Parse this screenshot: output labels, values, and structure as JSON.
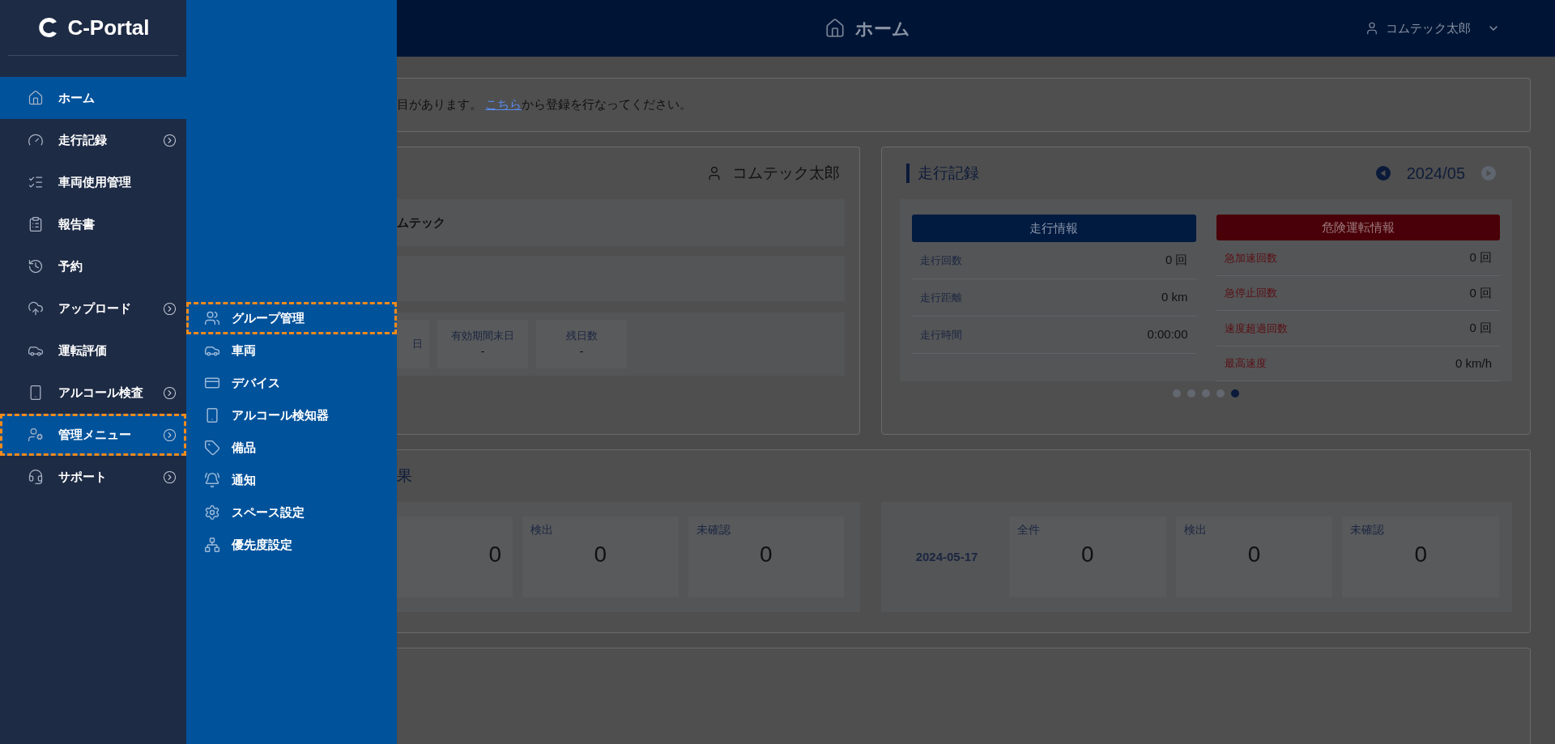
{
  "logo": {
    "text": "C-Portal"
  },
  "sidebar": {
    "items": [
      {
        "label": "ホーム",
        "selected": true,
        "highlighted": false,
        "has_submenu": false
      },
      {
        "label": "走行記録",
        "selected": false,
        "highlighted": false,
        "has_submenu": true
      },
      {
        "label": "車両使用管理",
        "selected": false,
        "highlighted": false,
        "has_submenu": false
      },
      {
        "label": "報告書",
        "selected": false,
        "highlighted": false,
        "has_submenu": false
      },
      {
        "label": "予約",
        "selected": false,
        "highlighted": false,
        "has_submenu": false
      },
      {
        "label": "アップロード",
        "selected": false,
        "highlighted": false,
        "has_submenu": true
      },
      {
        "label": "運転評価",
        "selected": false,
        "highlighted": false,
        "has_submenu": false
      },
      {
        "label": "アルコール検査",
        "selected": false,
        "highlighted": false,
        "has_submenu": true
      },
      {
        "label": "管理メニュー",
        "selected": true,
        "highlighted": true,
        "has_submenu": true
      },
      {
        "label": "サポート",
        "selected": false,
        "highlighted": false,
        "has_submenu": true
      }
    ]
  },
  "submenu": {
    "items": [
      {
        "label": "グループ管理",
        "highlighted": true
      },
      {
        "label": "車両",
        "highlighted": false
      },
      {
        "label": "デバイス",
        "highlighted": false
      },
      {
        "label": "アルコール検知器",
        "highlighted": false
      },
      {
        "label": "備品",
        "highlighted": false
      },
      {
        "label": "通知",
        "highlighted": false
      },
      {
        "label": "スペース設定",
        "highlighted": false
      },
      {
        "label": "優先度設定",
        "highlighted": false
      }
    ]
  },
  "header": {
    "title": "ホーム",
    "user": "コムテック太郎"
  },
  "notice": {
    "before": "目があります。",
    "link": "こちら",
    "after": "から登録を行なってください。"
  },
  "profile_card": {
    "user": "コムテック太郎",
    "company": "ムテック",
    "dates": [
      {
        "label": "日"
      },
      {
        "label": "有効期間末日",
        "value": "-"
      },
      {
        "label": "残日数",
        "value": "-"
      }
    ]
  },
  "drive_card": {
    "title": "走行記録",
    "month": "2024/05",
    "prev": {
      "disabled": false
    },
    "next": {
      "disabled": true
    },
    "columns": [
      {
        "kind": "info",
        "title": "走行情報",
        "rows": [
          {
            "label": "走行回数",
            "value": "0 回"
          },
          {
            "label": "走行距離",
            "value": "0 km"
          },
          {
            "label": "走行時間",
            "value": "0:00:00"
          }
        ]
      },
      {
        "kind": "danger",
        "title": "危険運転情報",
        "rows": [
          {
            "label": "急加速回数",
            "value": "0 回"
          },
          {
            "label": "急停止回数",
            "value": "0 回"
          },
          {
            "label": "速度超過回数",
            "value": "0 回"
          },
          {
            "label": "最高速度",
            "value": "0 km/h"
          }
        ]
      }
    ],
    "dots": [
      {
        "selected": false
      },
      {
        "selected": false
      },
      {
        "selected": false
      },
      {
        "selected": false
      },
      {
        "selected": true
      }
    ]
  },
  "result_card": {
    "title": "果",
    "left_stats": [
      {
        "value": "0"
      },
      {
        "label": "検出",
        "value": "0"
      },
      {
        "label": "未確認",
        "value": "0"
      }
    ],
    "date": "2024-05-17",
    "right_stats": [
      {
        "label": "全件",
        "value": "0"
      },
      {
        "label": "検出",
        "value": "0"
      },
      {
        "label": "未確認",
        "value": "0"
      }
    ]
  }
}
